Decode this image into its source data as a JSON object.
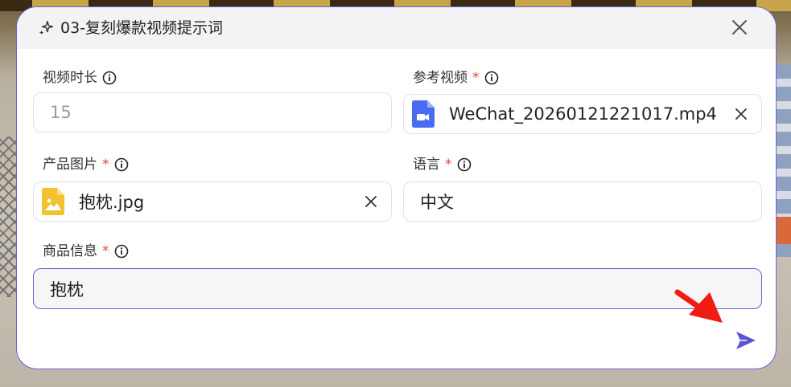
{
  "dialog": {
    "title": "03-复刻爆款视频提示词",
    "close_icon": "close-icon",
    "accent_color": "#5b55d6"
  },
  "fields": {
    "duration": {
      "label": "视频时长",
      "required": false,
      "placeholder": "15",
      "value": ""
    },
    "reference_video": {
      "label": "参考视频",
      "required": true,
      "required_mark": "*",
      "file_name": "WeChat_20260121221017.mp4",
      "file_icon": "video-file-icon"
    },
    "product_image": {
      "label": "产品图片",
      "required": true,
      "required_mark": "*",
      "file_name": "抱枕.jpg",
      "file_icon": "image-file-icon"
    },
    "language": {
      "label": "语言",
      "required": true,
      "required_mark": "*",
      "value": "中文"
    },
    "product_info": {
      "label": "商品信息",
      "required": true,
      "required_mark": "*",
      "value": "抱枕"
    }
  },
  "actions": {
    "send_icon": "send-icon"
  }
}
